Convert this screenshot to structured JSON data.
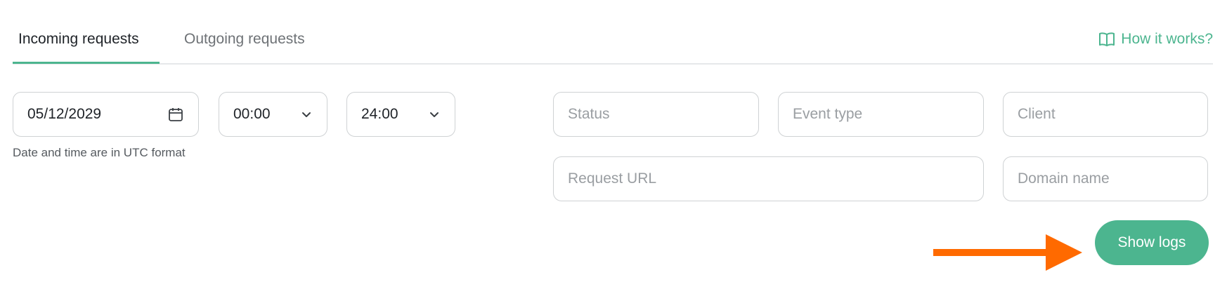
{
  "tabs": [
    {
      "label": "Incoming requests",
      "active": true
    },
    {
      "label": "Outgoing requests",
      "active": false
    }
  ],
  "help": {
    "label": "How it works?",
    "icon": "book-icon"
  },
  "filters": {
    "date": {
      "value": "05/12/2029",
      "icon": "calendar-icon"
    },
    "time_from": {
      "value": "00:00",
      "icon": "chevron-down-icon"
    },
    "time_to": {
      "value": "24:00",
      "icon": "chevron-down-icon"
    },
    "hint": "Date and time are in UTC format",
    "status": {
      "placeholder": "Status"
    },
    "event_type": {
      "placeholder": "Event type"
    },
    "client": {
      "placeholder": "Client"
    },
    "request_url": {
      "placeholder": "Request URL"
    },
    "domain_name": {
      "placeholder": "Domain name"
    }
  },
  "actions": {
    "show_logs": "Show logs"
  },
  "colors": {
    "accent": "#4cb58f",
    "annotation_arrow": "#ff6a00",
    "border": "#cfd2d4",
    "placeholder": "#9a9ea2"
  }
}
